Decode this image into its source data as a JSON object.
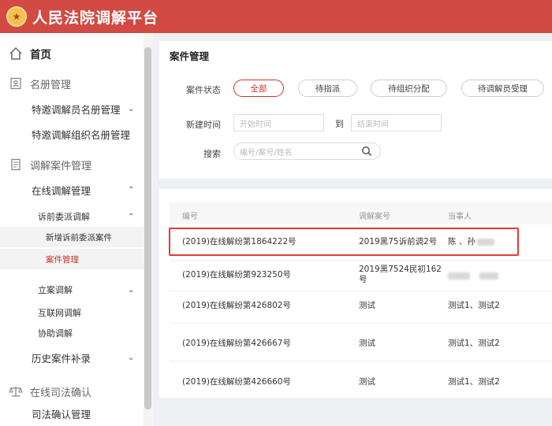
{
  "header": {
    "title": "人民法院调解平台"
  },
  "sidebar": {
    "home": "首页",
    "roster": "名册管理",
    "roster_items": [
      "特邀调解员名册管理",
      "特邀调解组织名册管理"
    ],
    "cases": "调解案件管理",
    "online": "在线调解管理",
    "presuit": "诉前委派调解",
    "presuit_items": [
      "新增诉前委派案件",
      "案件管理"
    ],
    "other_items": [
      "立案调解",
      "互联网调解",
      "协助调解"
    ],
    "history": "历史案件补录",
    "judicial": "在线司法确认",
    "judicial_items": [
      "司法确认管理"
    ]
  },
  "main": {
    "title": "案件管理",
    "status_label": "案件状态",
    "status_options": [
      "全部",
      "待指派",
      "待组织分配",
      "待调解员受理"
    ],
    "time_label": "新建时间",
    "start_placeholder": "开始时间",
    "to": "到",
    "end_placeholder": "结束时间",
    "search_label": "搜索",
    "search_placeholder": "编号/案号/姓名"
  },
  "table": {
    "columns": [
      "编号",
      "调解案号",
      "当事人"
    ],
    "rows": [
      {
        "id": "(2019)在线解纷第1864222号",
        "case_no": "2019黑75诉前调2号",
        "parties": "陈   、孙"
      },
      {
        "id": "(2019)在线解纷第923250号",
        "case_no": "2019黑7524民初162号",
        "parties": ""
      },
      {
        "id": "(2019)在线解纷第426802号",
        "case_no": "测试",
        "parties": "测试1、测试2"
      },
      {
        "id": "(2019)在线解纷第426667号",
        "case_no": "测试",
        "parties": "测试1、测试2"
      },
      {
        "id": "(2019)在线解纷第426660号",
        "case_no": "测试",
        "parties": "测试1、测试2"
      }
    ]
  },
  "colors": {
    "brand": "#d24a43",
    "accent": "#c4382f",
    "highlight": "#e53b35"
  },
  "icons": [
    "emblem-icon",
    "home-icon",
    "roster-icon",
    "document-icon",
    "scale-icon",
    "search-icon",
    "chevron-down-icon",
    "chevron-up-icon"
  ]
}
